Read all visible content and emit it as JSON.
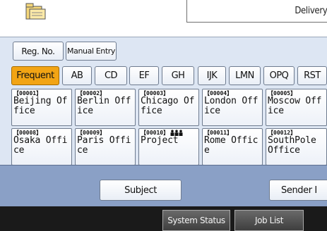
{
  "header": {
    "delivery_label": "Delivery S"
  },
  "buttons": {
    "reg_no": "Reg. No.",
    "manual_entry": "Manual Entry"
  },
  "tabs": [
    {
      "label": "Frequent",
      "active": true
    },
    {
      "label": "AB"
    },
    {
      "label": "CD"
    },
    {
      "label": "EF"
    },
    {
      "label": "GH"
    },
    {
      "label": "IJK"
    },
    {
      "label": "LMN"
    },
    {
      "label": "OPQ"
    },
    {
      "label": "RST"
    }
  ],
  "entries": [
    {
      "num": "【00001】",
      "line1": "Beijing Of",
      "line2": "fice"
    },
    {
      "num": "【00002】",
      "line1": "Berlin Off",
      "line2": "ice"
    },
    {
      "num": "【00003】",
      "line1": "Chicago Of",
      "line2": "fice"
    },
    {
      "num": "【00004】",
      "line1": "London Off",
      "line2": "ice"
    },
    {
      "num": "【00005】",
      "line1": "Moscow Off",
      "line2": "ice"
    },
    {
      "num": "【00008】",
      "line1": "Osaka Offi",
      "line2": "ce"
    },
    {
      "num": "【00009】",
      "line1": "Paris Offi",
      "line2": "ce"
    },
    {
      "num": "【00010】",
      "line1": "Project",
      "line2": "",
      "group_icon": "group-icon"
    },
    {
      "num": "【00011】",
      "line1": "Rome Offic",
      "line2": "e"
    },
    {
      "num": "【00012】",
      "line1": "SouthPole",
      "line2": "Office"
    }
  ],
  "bottom": {
    "subject": "Subject",
    "sender": "Sender I"
  },
  "status": {
    "system_status": "System Status",
    "job_list": "Job List"
  },
  "colors": {
    "panel_bg": "#dde6f3",
    "active_tab": "#f2a414",
    "bottom_bar": "#8aa0c6",
    "status_bar": "#1a1a1a"
  }
}
